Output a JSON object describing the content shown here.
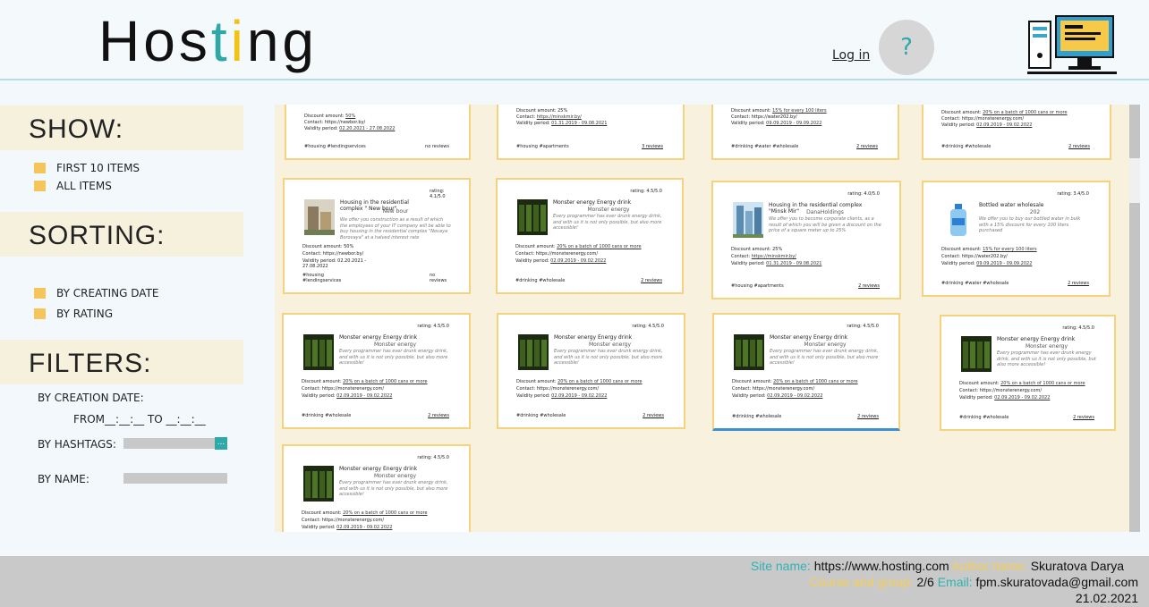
{
  "header": {
    "logo": {
      "part1": "Hos",
      "part2": "t",
      "part3": "i",
      "part4": "ng"
    },
    "login": "Log in",
    "help": "?"
  },
  "sidebar": {
    "show": {
      "title": "SHOW:",
      "options": [
        "FIRST 10 ITEMS",
        "ALL ITEMS"
      ]
    },
    "sorting": {
      "title": "SORTING:",
      "options": [
        "BY CREATING DATE",
        "BY RATING"
      ]
    },
    "filters": {
      "title": "FILTERS:",
      "by_creation_date": "BY CREATION DATE:",
      "from_to": "FROM__:__:__ TO __:__:__",
      "by_hashtags": "BY HASHTAGS:",
      "by_name": "BY NAME:",
      "hashtags_button": "..."
    }
  },
  "cards": [
    {
      "discount": "Discount amount: ",
      "discount_val": "50%",
      "contact": "Contact: https://newbor.by/",
      "validity": "Validity period: ",
      "validity_val": "02.20.2021 - 27.08.2022",
      "tags": "#housing #lendingservices",
      "reviews": "no reviews"
    },
    {
      "discount": "Discount amount: 25%",
      "discount_val": "",
      "contact": "Contact: ",
      "contact_val": "https://minskmir.by/",
      "validity": "Validity period: ",
      "validity_val": "01.31.2019 - 09.08.2021",
      "tags": "#housing #apartments",
      "reviews": "3 reviews"
    },
    {
      "discount": "Discount amount: ",
      "discount_val": "15% for every 100 liters",
      "contact": "Contact: https://water202.by/",
      "validity": "Validity period: ",
      "validity_val": "09.09.2019 - 09.09.2022",
      "tags": "#drinking #water #wholesale",
      "reviews": "2 reviews"
    },
    {
      "discount": "Discount amount: ",
      "discount_val": "20% on a batch of 1000 cans or more",
      "contact": "Contact: https://monsterenergy.com/",
      "validity": "Validity period: ",
      "validity_val": "02.09.2019 - 09.02.2022",
      "tags": "#drinking #wholesale",
      "reviews": "2 reviews"
    },
    {
      "rating": "rating: 4.1/5.0",
      "title": "Housing in the residential complex \" New bour\"",
      "company": "New bour",
      "desc": "We offer you construction as a result of which the employees of your IT company will be able to buy housing in the residential complex \"Novaya Borovaya\" at a halved interest rate",
      "discount": "Discount amount: 50%",
      "contact": "Contact: https://newbor.by/",
      "validity": "Validity period: 02.20.2021 - 27.08.2022",
      "tags": "#housing #lendingservices",
      "reviews": "no reviews"
    },
    {
      "rating": "rating: 4.5/5.0",
      "title": "Monster energy Energy drink",
      "company": "Monster energy",
      "desc": "Every programmer has ever drunk energy drink, and with us it is not only possible, but also more accessible!",
      "discount": "Discount amount: ",
      "discount_val": "20% on a batch of 1000 cans or more",
      "contact": "Contact: https://monsterenergy.com/",
      "validity": "Validity period: ",
      "validity_val": "02.09.2019 - 09.02.2022",
      "tags": "#drinking #wholesale",
      "reviews": "2 reviews"
    },
    {
      "rating": "rating: 4.0/5.0",
      "title": "Housing in the residential complex \"Minsk Mir\"",
      "company": "DanaHoldings",
      "desc": "We offer you to become corporate clients, as a result of which you will be given a discount on the price of a square meter up to 25%",
      "discount": "Discount amount: 25%",
      "contact": "Contact: ",
      "contact_val": "https://minskmir.by/",
      "validity": "Validity period: ",
      "validity_val": "01.31.2019 - 09.08.2021",
      "tags": "#housing #apartments",
      "reviews": "2 reviews"
    },
    {
      "rating": "rating: 3.4/5.0",
      "title": "Bottled water wholesale",
      "company": "202",
      "desc": "We offer you to buy our bottled water in bulk with a 15% discount for every 100 liters purchased",
      "discount": "Discount amount: ",
      "discount_val": "15% for every 100 liters",
      "contact": "Contact: https://water202.by/",
      "validity": "Validity period: ",
      "validity_val": "09.09.2019 - 09.09.2022",
      "tags": "#drinking #water #wholesale",
      "reviews": "2 reviews"
    },
    {
      "rating": "rating: 4.5/5.0",
      "title": "Monster energy Energy drink",
      "company": "Monster energy",
      "desc": "Every programmer has ever drunk energy drink, and with us it is not only possible, but also more accessible!",
      "discount": "Discount amount: ",
      "discount_val": "20% on a batch of 1000 cans or more",
      "contact": "Contact: https://monsterenergy.com/",
      "validity": "Validity period: ",
      "validity_val": "02.09.2019 - 09.02.2022",
      "tags": "#drinking #wholesale",
      "reviews": "2 reviews"
    },
    {
      "rating": "rating: 4.5/5.0",
      "title": "Monster energy Energy drink",
      "company": "Monster energy",
      "desc": "Every programmer has ever drunk energy drink, and with us it is not only possible, but also more accessible!",
      "discount": "Discount amount: ",
      "discount_val": "20% on a batch of 1000 cans or more",
      "contact": "Contact: https://monsterenergy.com/",
      "validity": "Validity period: ",
      "validity_val": "02.09.2019 - 09.02.2022",
      "tags": "#drinking #wholesale",
      "reviews": "2 reviews"
    },
    {
      "rating": "rating: 4.5/5.0",
      "title": "Monster energy Energy drink",
      "company": "Monster energy",
      "desc": "Every programmer has ever drunk energy drink, and with us it is not only possible, but also more accessible!",
      "discount": "Discount amount: ",
      "discount_val": "20% on a batch of 1000 cans or more",
      "contact": "Contact: https://monsterenergy.com/",
      "validity": "Validity period: ",
      "validity_val": "02.09.2019 - 09.02.2022",
      "tags": "#drinking #wholesale",
      "reviews": "2 reviews"
    },
    {
      "rating": "rating: 4.5/5.0",
      "title": "Monster energy Energy drink",
      "company": "Monster energy",
      "desc": "Every programmer has ever drunk energy drink, and with us it is not only possible, but also more accessible!",
      "discount": "Discount amount: ",
      "discount_val": "20% on a batch of 1000 cans or more",
      "contact": "Contact: https://monsterenergy.com/",
      "validity": "Validity period: ",
      "validity_val": "02.09.2019 - 09.02.2022",
      "tags": "#drinking #wholesale",
      "reviews": "2 reviews"
    },
    {
      "rating": "rating: 4.5/5.0",
      "title": "Monster energy Energy drink",
      "company": "Monster energy",
      "desc": "Every programmer has ever drunk energy drink, and with us it is not only possible, but also more accessible!",
      "discount": "Discount amount: ",
      "discount_val": "20% on a batch of 1000 cans or more",
      "contact": "Contact: https://monsterenergy.com/",
      "validity": "Validity period: ",
      "validity_val": "02.09.2019 - 09.02.2022"
    }
  ],
  "footer": {
    "site_name_key": "Site name:",
    "site_name_val": "https://www.hosting.com",
    "author_key": "Author name:",
    "author_val": "Skuratova Darya",
    "course_key": "Course and group:",
    "course_val": "2/6",
    "email_key": "Email:",
    "email_val": "fpm.skuratovada@gmail.com",
    "date": "21.02.2021"
  },
  "colors": {
    "accent_teal": "#2fa8a8",
    "accent_yellow": "#f3c313",
    "card_border": "#f5d27d",
    "panel_bg": "#f8f1dd"
  }
}
